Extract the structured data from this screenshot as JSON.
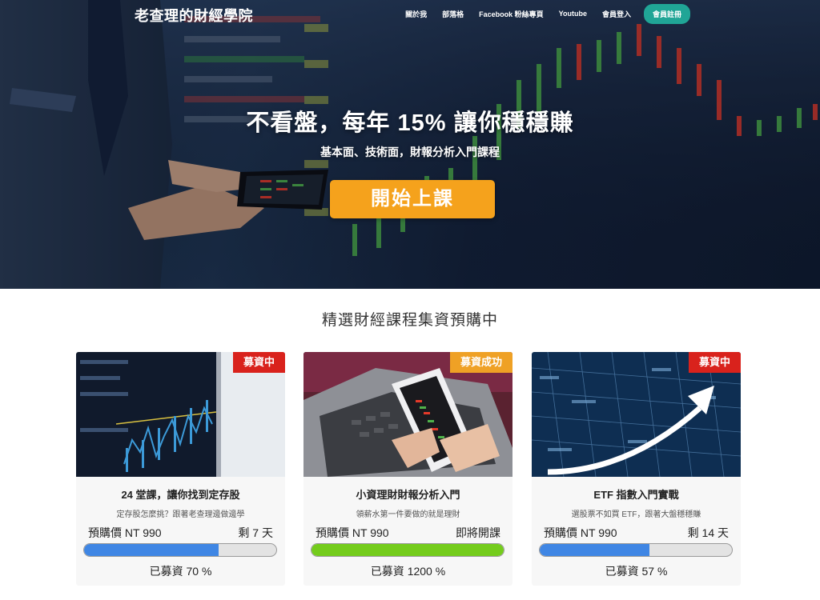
{
  "nav": {
    "brand": "老查理的財經學院",
    "links": [
      "關於我",
      "部落格",
      "Facebook 粉絲專頁",
      "Youtube",
      "會員登入"
    ],
    "signup": "會員註冊"
  },
  "hero": {
    "title": "不看盤，每年 15% 讓你穩穩賺",
    "subtitle": "基本面、技術面，財報分析入門課程",
    "cta": "開始上課"
  },
  "section": {
    "title": "精選財經課程集資預購中"
  },
  "colors": {
    "accent_teal": "#20a596",
    "cta_orange": "#f5a21c",
    "badge_red": "#d9221c",
    "badge_orange": "#efa125",
    "progress_blue": "#3f86e4",
    "progress_green": "#74cc1c"
  },
  "cards": [
    {
      "badge": "募資中",
      "image": "stock-chart-monitor-image",
      "title": "24 堂課，讓你找到定存股",
      "desc": "定存股怎麼挑？跟著老查理邊做邊學",
      "price": "預購價 NT 990",
      "remain": "剩 7 天",
      "progress_pct": 70,
      "raised": "已募資 70 %"
    },
    {
      "badge": "募資成功",
      "image": "phone-laptop-trading-image",
      "title": "小資理財財報分析入門",
      "desc": "領薪水第一件要做的就是理財",
      "price": "預購價 NT 990",
      "remain": "即將開課",
      "progress_pct": 100,
      "raised": "已募資 1200 %"
    },
    {
      "badge": "募資中",
      "image": "rising-arrow-image",
      "title": "ETF 指數入門實戰",
      "desc": "選股票不如買 ETF，跟著大盤穩穩賺",
      "price": "預購價 NT 990",
      "remain": "剩 14 天",
      "progress_pct": 57,
      "raised": "已募資 57 %"
    }
  ]
}
